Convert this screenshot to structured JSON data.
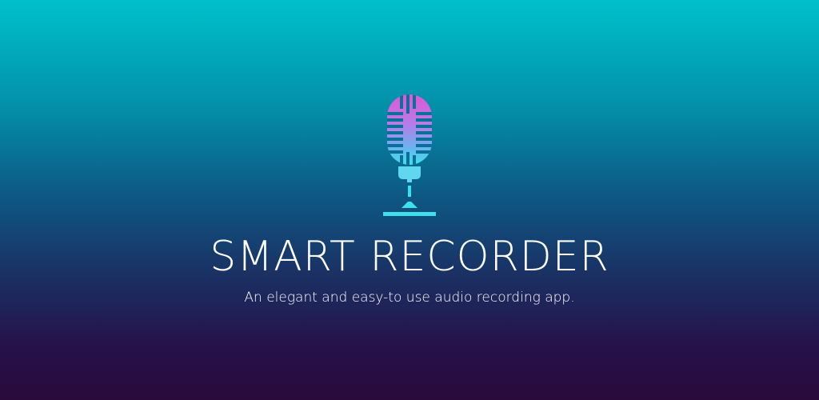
{
  "app": {
    "title": "SMART RECORDER",
    "tagline": "An elegant and easy-to use audio recording app."
  },
  "logo": {
    "icon": "microphone-icon",
    "gradient_top": "#e056d8",
    "gradient_bottom": "#3fe0ea"
  },
  "colors": {
    "background_top": "#00c1cb",
    "background_bottom": "#290a3b",
    "text": "#ffffff"
  }
}
